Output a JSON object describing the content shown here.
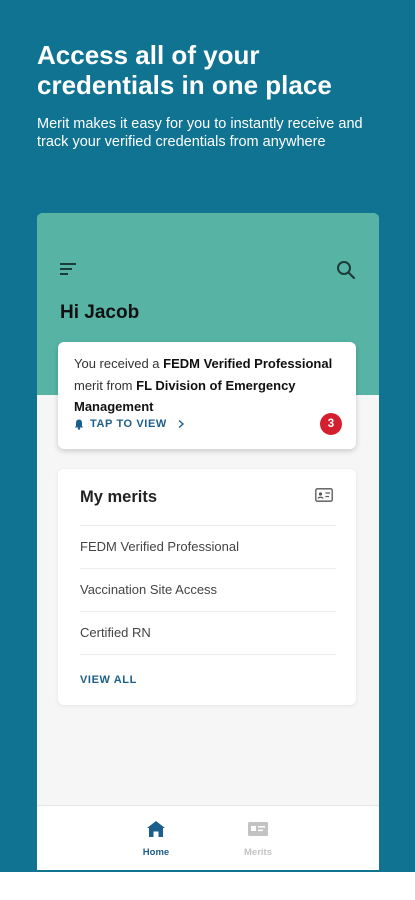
{
  "hero": {
    "headline": "Access all of your credentials in one place",
    "subheadline": "Merit makes it easy for you to instantly receive and track your verified credentials from anywhere"
  },
  "app": {
    "greeting": "Hi Jacob",
    "notification": {
      "part1": "You received a ",
      "merit_name": "FEDM Verified Professional",
      "part2": " merit from ",
      "issuer": "FL Division of Emergency Management",
      "link_label": "TAP TO VIEW",
      "badge_count": "3"
    },
    "my_merits": {
      "title": "My merits",
      "items": [
        {
          "label": "FEDM Verified Professional"
        },
        {
          "label": "Vaccination Site Access"
        },
        {
          "label": "Certified RN"
        }
      ],
      "view_all_label": "VIEW ALL"
    },
    "nav": {
      "home_label": "Home",
      "merits_label": "Merits"
    }
  },
  "colors": {
    "background": "#0f7391",
    "header_green": "#57b4a5",
    "link_blue": "#1c5f8c",
    "badge_red": "#d3202f"
  },
  "icons": [
    "filter-menu-icon",
    "search-icon",
    "bell-icon",
    "chevron-right-icon",
    "id-card-icon",
    "home-icon",
    "merits-card-icon"
  ]
}
